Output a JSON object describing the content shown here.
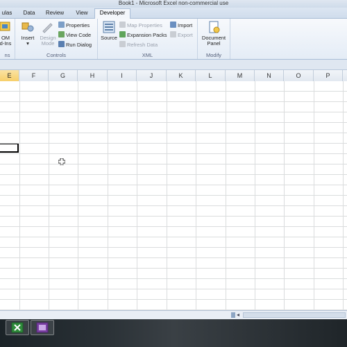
{
  "window": {
    "title": "Book1 - Microsoft Excel non-commercial use"
  },
  "tabs": [
    {
      "label": "ulas",
      "active": false
    },
    {
      "label": "Data",
      "active": false
    },
    {
      "label": "Review",
      "active": false
    },
    {
      "label": "View",
      "active": false
    },
    {
      "label": "Developer",
      "active": true
    }
  ],
  "ribbon": {
    "addins_group": {
      "button_line1": "OM",
      "button_line2": "d-Ins",
      "label": "ns"
    },
    "controls_group": {
      "label": "Controls",
      "insert_label": "Insert",
      "design_mode_line1": "Design",
      "design_mode_line2": "Mode",
      "properties_label": "Properties",
      "view_code_label": "View Code",
      "run_dialog_label": "Run Dialog"
    },
    "xml_group": {
      "label": "XML",
      "source_label": "Source",
      "map_properties_label": "Map Properties",
      "expansion_packs_label": "Expansion Packs",
      "refresh_data_label": "Refresh Data",
      "import_label": "Import",
      "export_label": "Export"
    },
    "modify_group": {
      "label": "Modify",
      "document_panel_line1": "Document",
      "document_panel_line2": "Panel"
    }
  },
  "columns": [
    "E",
    "F",
    "G",
    "H",
    "I",
    "J",
    "K",
    "L",
    "M",
    "N",
    "O",
    "P"
  ],
  "selected_column": "E",
  "icons": {
    "addins": "com-addins-icon",
    "insert": "insert-control-icon",
    "design_mode": "design-mode-icon",
    "properties": "properties-icon",
    "view_code": "view-code-icon",
    "run_dialog": "run-dialog-icon",
    "source": "xml-source-icon",
    "document_panel": "document-panel-icon",
    "cursor": "cell-cursor-icon"
  },
  "colors": {
    "accent": "#f7cf6a",
    "ribbon_border": "#a9bdd6"
  }
}
